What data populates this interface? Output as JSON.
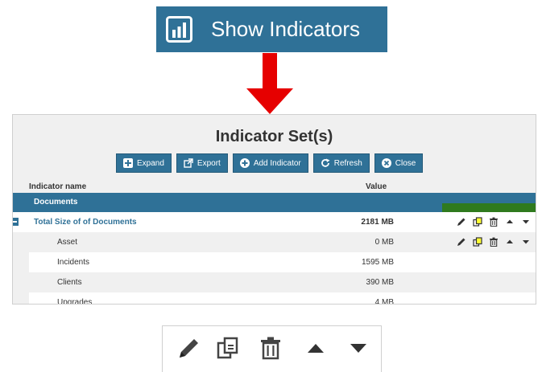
{
  "show_button": {
    "label": "Show Indicators",
    "icon": "bar-chart-icon"
  },
  "arrow": {
    "color": "#e60000"
  },
  "panel": {
    "title": "Indicator Set(s)",
    "toolbar": [
      {
        "label": "Expand",
        "icon": "plus-square-icon"
      },
      {
        "label": "Export",
        "icon": "external-link-icon"
      },
      {
        "label": "Add Indicator",
        "icon": "plus-circle-icon"
      },
      {
        "label": "Refresh",
        "icon": "refresh-icon"
      },
      {
        "label": "Close",
        "icon": "close-circle-icon"
      }
    ],
    "columns": {
      "name": "Indicator name",
      "value": "Value"
    },
    "group": "Documents",
    "rows": [
      {
        "name": "Total Size of of Documents",
        "value": "2181 MB",
        "type": "total"
      },
      {
        "name": "Asset",
        "value": "0 MB",
        "type": "child"
      },
      {
        "name": "Incidents",
        "value": "1595 MB",
        "type": "child"
      },
      {
        "name": "Clients",
        "value": "390 MB",
        "type": "child"
      },
      {
        "name": "Upgrades",
        "value": "4 MB",
        "type": "child"
      }
    ]
  },
  "action_icons": [
    "pencil-icon",
    "copy-icon",
    "trash-icon",
    "arrow-up-icon",
    "arrow-down-icon"
  ],
  "colors": {
    "primary": "#2f7197",
    "highlight": "#ffff33",
    "highlight_top": "#2f7a1e"
  }
}
